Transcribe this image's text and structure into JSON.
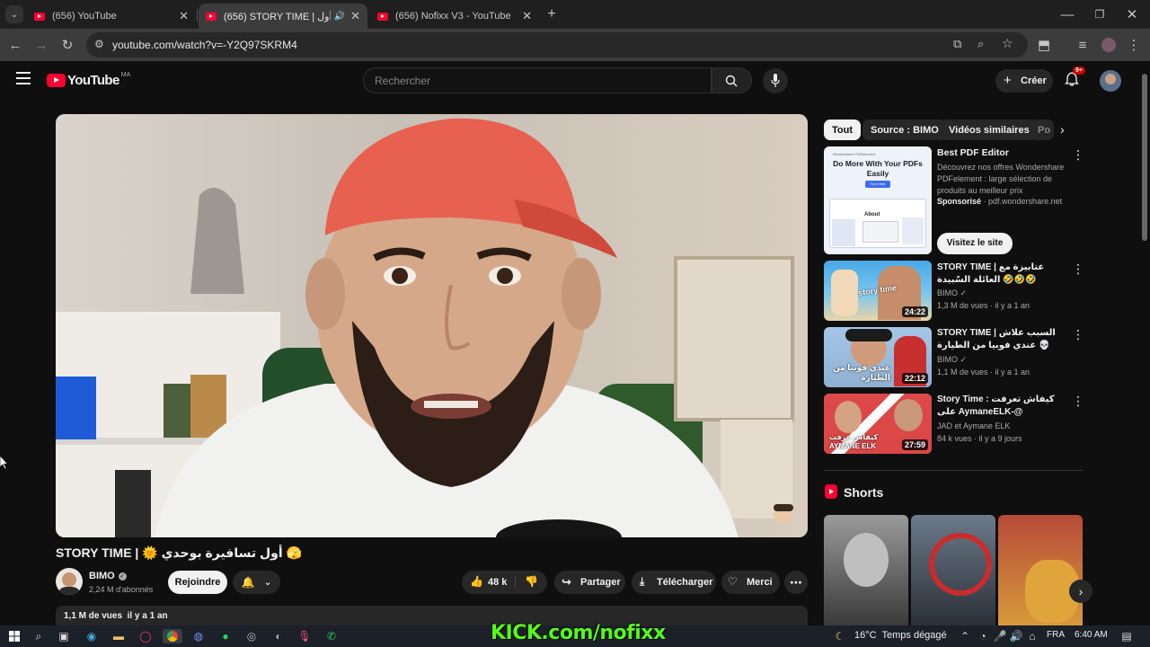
{
  "browser": {
    "tabs": [
      {
        "title": "(656) YouTube",
        "active": false
      },
      {
        "title": "(656) STORY TIME | أول",
        "active": true
      },
      {
        "title": "(656) Nofixx V3 - YouTube",
        "active": false
      }
    ],
    "new_tab_label": "+",
    "url": "youtube.com/watch?v=-Y2Q97SKRM4"
  },
  "youtube": {
    "logo_text": "YouTube",
    "country_code": "MA",
    "search_placeholder": "Rechercher",
    "create_label": "Créer",
    "notifications_count": "9+"
  },
  "video": {
    "title": "STORY TIME | 🌞 أول تسافيرة بوحدي 🫣",
    "channel": "BIMO",
    "subscribers": "2,24 M d'abonnés",
    "join_label": "Rejoindre",
    "likes": "48 k",
    "share_label": "Partager",
    "download_label": "Télécharger",
    "thanks_label": "Merci",
    "description_meta": "1,1 M de vues  il y a 1 an"
  },
  "sidebar": {
    "chips": [
      {
        "label": "Tout",
        "active": true
      },
      {
        "label": "Source : BIMO",
        "active": false
      },
      {
        "label": "Vidéos similaires",
        "active": false
      },
      {
        "label": "Po",
        "active": false
      }
    ],
    "ad": {
      "title": "Best PDF Editor",
      "description": "Découvrez nos offres Wondershare PDFelement : large sélection de produits au meilleur prix",
      "sponsored": "Sponsorisé",
      "domain": "pdf.wondershare.net",
      "cta": "Visitez le site",
      "thumb_brand": "Wondershare PDFelement",
      "thumb_headline": "Do More With Your PDFs Easily",
      "thumb_button": "Try it free",
      "thumb_label": "About"
    },
    "videos": [
      {
        "title": "STORY TIME | عتابيزة مع العائلة السّبيدة 🤣🤣🤣",
        "channel": "BIMO",
        "views": "1,3 M de vues",
        "age": "il y a 1 an",
        "duration": "24:22",
        "thumb_text": "story time"
      },
      {
        "title": "STORY TIME | السبب علاش عندي فوبيا من الطيارة 💀",
        "channel": "BIMO",
        "views": "1,1 M de vues",
        "age": "il y a 1 an",
        "duration": "22:12",
        "thumb_text": "عندي فوبيا من الطيارة"
      },
      {
        "title": "Story Time : كيفاش تعرفت على AymaneELK-@",
        "channel": "JAD et Aymane ELK",
        "views": "84 k vues",
        "age": "il y a 9 jours",
        "duration": "27:59",
        "thumb_text": "كيفاش عرفت AYMANE ELK"
      }
    ],
    "shorts_title": "Shorts"
  },
  "taskbar": {
    "weather": "16°C  Temps dégagé",
    "language": "FRA",
    "time": "6:40 AM",
    "overlay_text": "KICK.com/nofixx"
  },
  "colors": {
    "yt_red": "#ff0033",
    "background": "#0f0f0f",
    "chip_bg": "#272727",
    "kick_green": "#53fc18"
  }
}
